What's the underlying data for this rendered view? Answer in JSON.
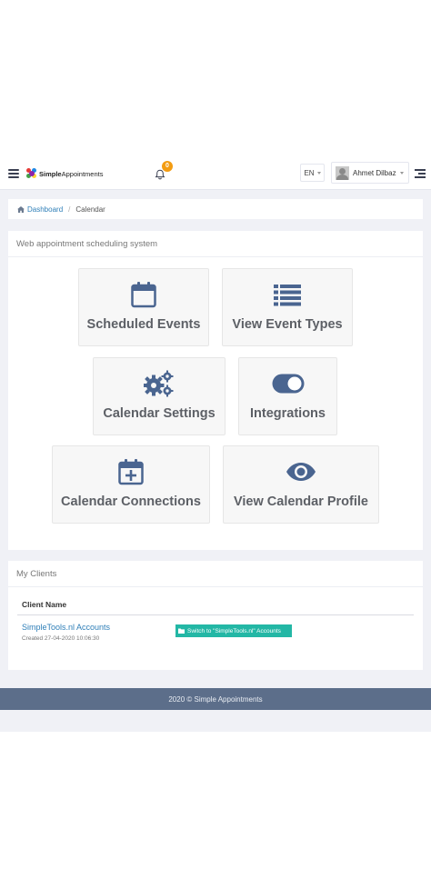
{
  "navbar": {
    "logo_bold": "Simple",
    "logo_light": "Appointments",
    "notifications_count": "0",
    "language": "EN",
    "user_name": "Ahmet Dilbaz"
  },
  "breadcrumb": {
    "home": "Dashboard",
    "current": "Calendar"
  },
  "main_panel": {
    "heading": "Web appointment scheduling system",
    "tiles": [
      {
        "label": "Scheduled Events",
        "icon": "calendar-icon"
      },
      {
        "label": "View Event Types",
        "icon": "list-icon"
      },
      {
        "label": "Calendar Settings",
        "icon": "gears-icon"
      },
      {
        "label": "Integrations",
        "icon": "toggle-icon"
      },
      {
        "label": "Calendar Connections",
        "icon": "calendar-plus-icon"
      },
      {
        "label": "View Calendar Profile",
        "icon": "eye-icon"
      }
    ]
  },
  "clients": {
    "heading": "My Clients",
    "column_client_name": "Client Name",
    "rows": [
      {
        "name": "SimpleTools.nl Accounts",
        "created": "Created 27-04-2020 10:06:30",
        "switch_label": "Switch to \"SimpleTools.nl\" Accounts"
      }
    ]
  },
  "footer": {
    "text": "2020 © Simple Appointments"
  },
  "colors": {
    "icon": "#4a6590",
    "link": "#2f7fb8",
    "badge": "#f39c12",
    "switch_button": "#23b7a5",
    "footer": "#5c6e8a"
  }
}
